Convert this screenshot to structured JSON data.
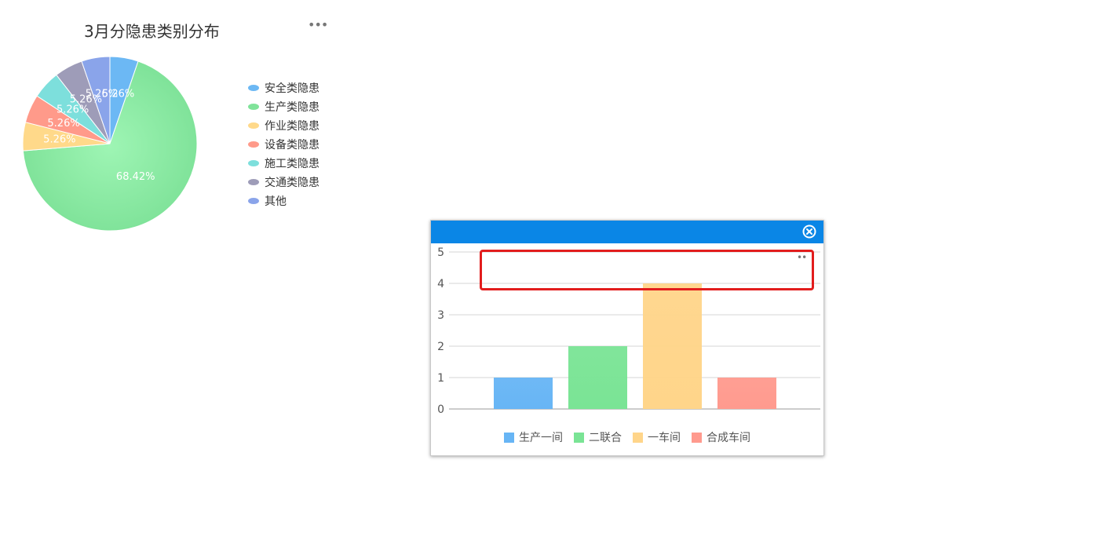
{
  "pie": {
    "more_label": "•••",
    "chart_data": {
      "type": "pie",
      "title": "3月分隐患类别分布",
      "categories": [
        "安全类隐患",
        "生产类隐患",
        "作业类隐患",
        "设备类隐患",
        "施工类隐患",
        "交通类隐患",
        "其他"
      ],
      "values": [
        5.26,
        68.42,
        5.26,
        5.26,
        5.26,
        5.26,
        5.26
      ],
      "labels": [
        "5.26%",
        "68.42%",
        "5.26%",
        "5.26%",
        "5.26%",
        "5.26%",
        "5.26%"
      ],
      "colors": [
        "#6cb8f4",
        "#80e39a",
        "#ffd98a",
        "#ff9a8a",
        "#7ddfdc",
        "#9e9cb8",
        "#8aa4ea"
      ],
      "legend_position": "right"
    }
  },
  "bar": {
    "more_label": "••",
    "chart_data": {
      "type": "bar",
      "categories": [
        "生产一间",
        "二联合",
        "一车间",
        "合成车间"
      ],
      "values": [
        1,
        2,
        4,
        1
      ],
      "colors": [
        "#67b5f5",
        "#7ae495",
        "#ffd58a",
        "#ff9a8e"
      ],
      "ylim": [
        0,
        5
      ],
      "yticks": [
        "0",
        "1",
        "2",
        "3",
        "4",
        "5"
      ],
      "grid": true,
      "legend_position": "bottom"
    }
  },
  "colors": {
    "header_blue": "#0a86e6",
    "highlight_red": "#e21d1d"
  }
}
